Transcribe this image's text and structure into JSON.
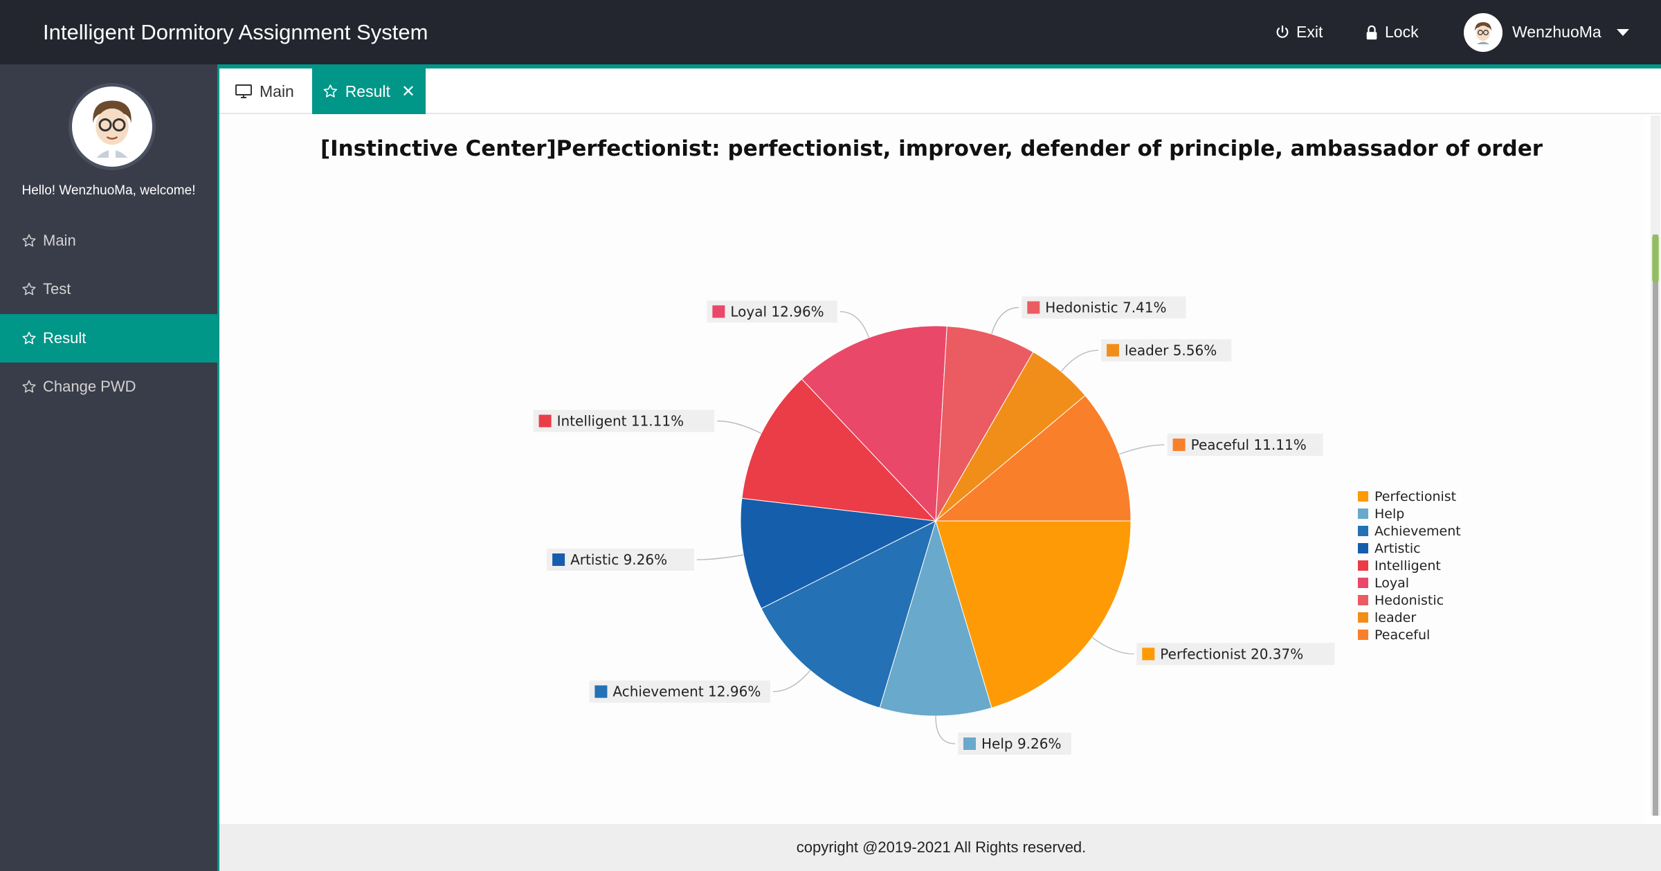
{
  "header": {
    "app_title": "Intelligent Dormitory Assignment System",
    "exit_label": "Exit",
    "lock_label": "Lock",
    "username": "WenzhuoMa"
  },
  "sidebar": {
    "welcome": "Hello!  WenzhuoMa, welcome!",
    "items": [
      {
        "label": "Main",
        "icon": "star-outline-icon",
        "active": false
      },
      {
        "label": "Test",
        "icon": "star-outline-icon",
        "active": false
      },
      {
        "label": "Result",
        "icon": "star-outline-icon",
        "active": true
      },
      {
        "label": "Change PWD",
        "icon": "star-outline-icon",
        "active": false
      }
    ]
  },
  "tabs": [
    {
      "label": "Main",
      "icon": "monitor-icon",
      "active": false
    },
    {
      "label": "Result",
      "icon": "star-outline-icon",
      "active": true,
      "closable": true
    }
  ],
  "footer": "copyright @2019-2021 All Rights reserved.",
  "chart_data": {
    "type": "pie",
    "title": "[Instinctive Center]Perfectionist: perfectionist, improver, defender of principle, ambassador of order",
    "legend_position": "right",
    "series": [
      {
        "name": "Perfectionist",
        "value": 20.37,
        "label": "Perfectionist 20.37%",
        "color": "#fe9a05"
      },
      {
        "name": "Help",
        "value": 9.26,
        "label": "Help 9.26%",
        "color": "#69a9cb"
      },
      {
        "name": "Achievement",
        "value": 12.96,
        "label": "Achievement 12.96%",
        "color": "#2471b5"
      },
      {
        "name": "Artistic",
        "value": 9.26,
        "label": "Artistic 9.26%",
        "color": "#155eac"
      },
      {
        "name": "Intelligent",
        "value": 11.11,
        "label": "Intelligent 11.11%",
        "color": "#ea3d48"
      },
      {
        "name": "Loyal",
        "value": 12.96,
        "label": "Loyal 12.96%",
        "color": "#ea4868"
      },
      {
        "name": "Hedonistic",
        "value": 7.41,
        "label": "Hedonistic 7.41%",
        "color": "#ea5c62"
      },
      {
        "name": "leader",
        "value": 5.56,
        "label": "leader 5.56%",
        "color": "#f18e19"
      },
      {
        "name": "Peaceful",
        "value": 11.11,
        "label": "Peaceful 11.11%",
        "color": "#f97f2a"
      }
    ]
  }
}
